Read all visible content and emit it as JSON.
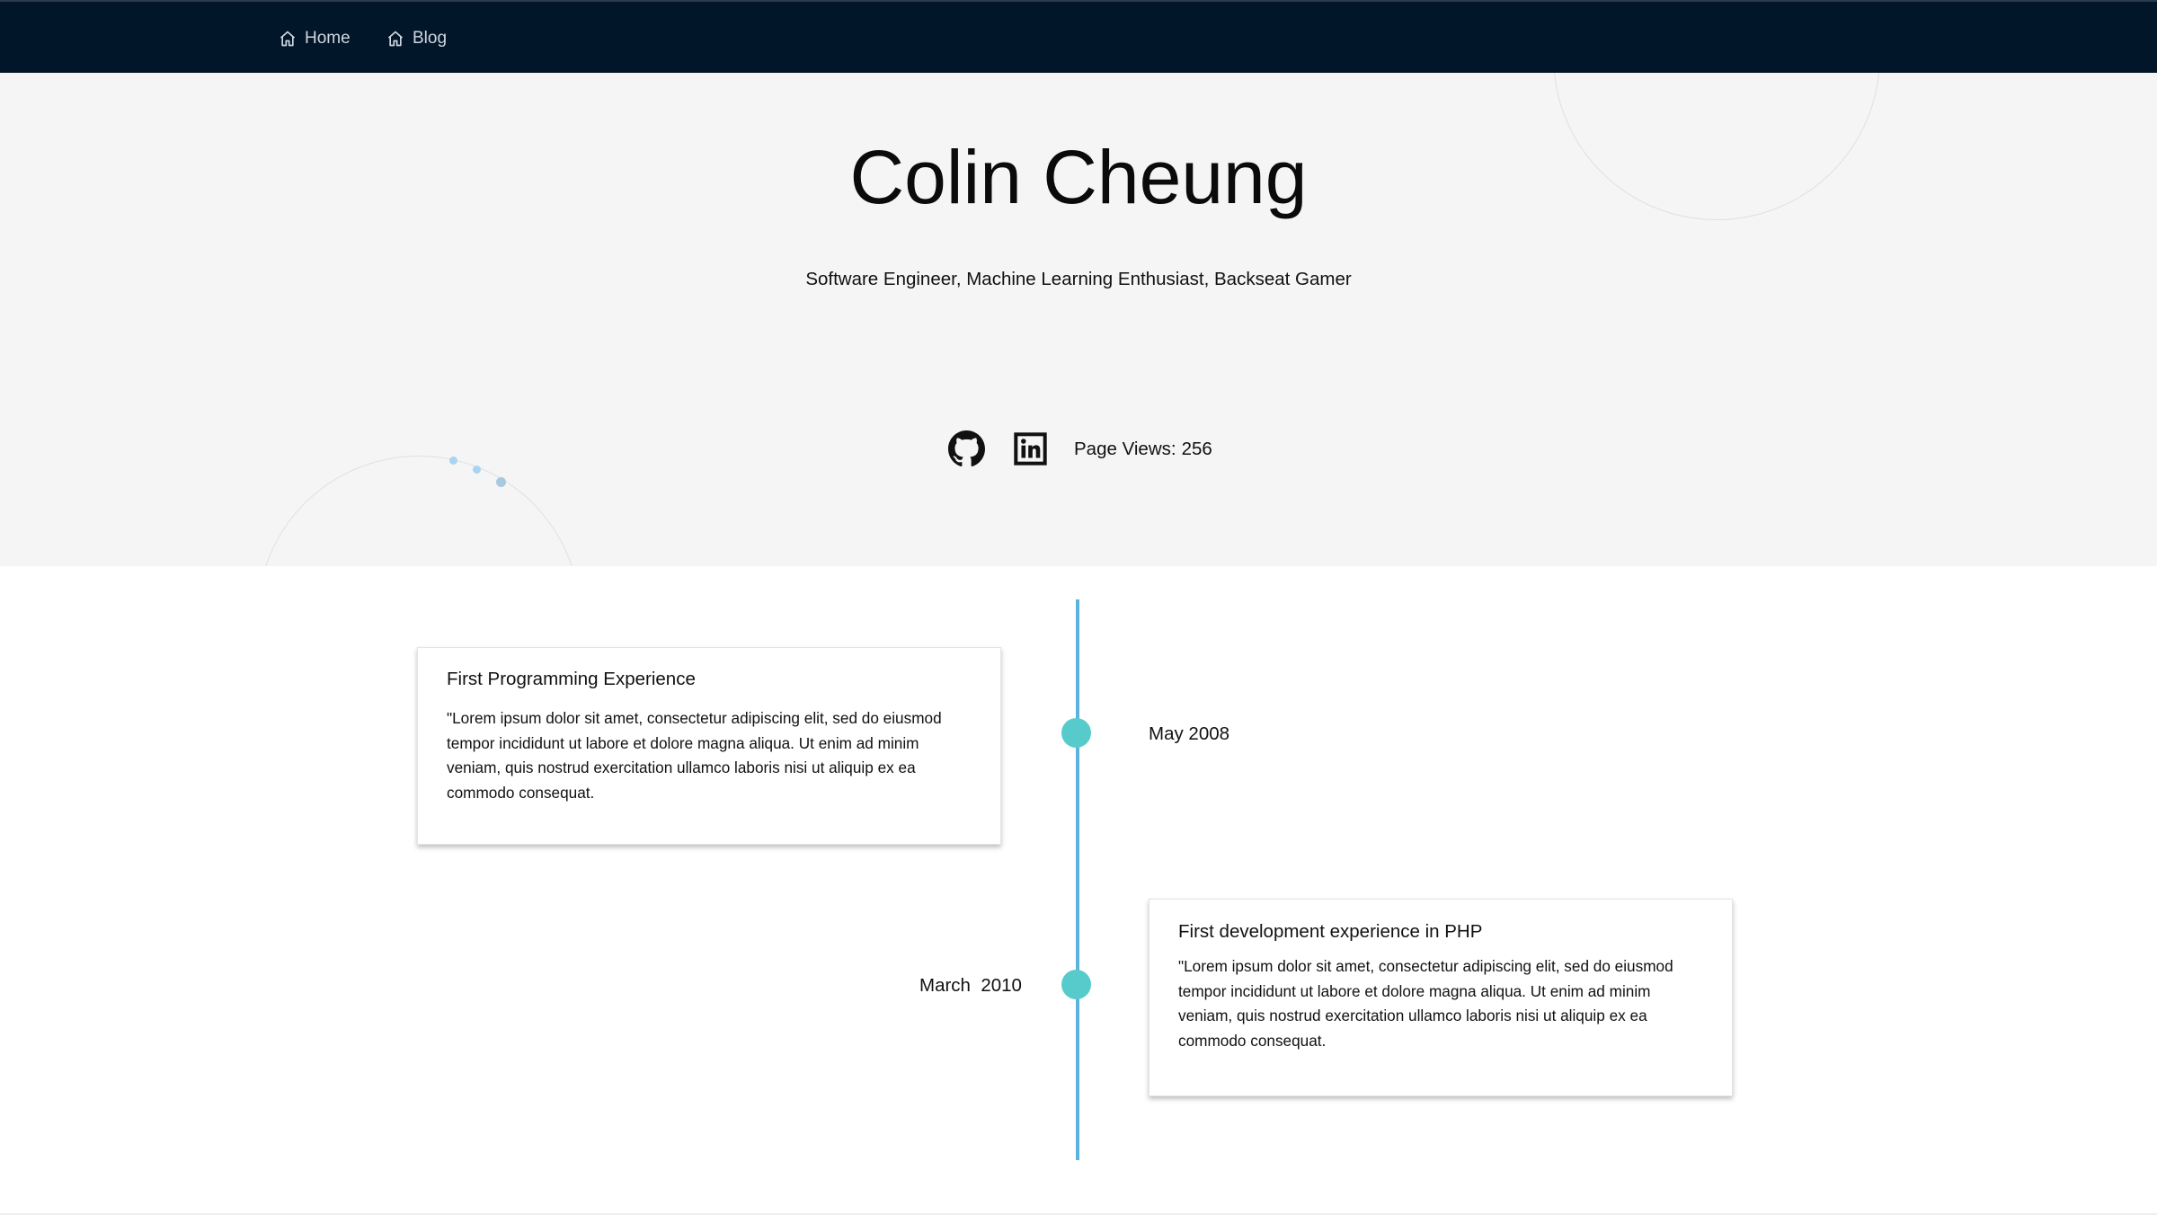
{
  "nav": {
    "items": [
      {
        "label": "Home",
        "icon": "home-icon"
      },
      {
        "label": "Blog",
        "icon": "home-icon"
      }
    ]
  },
  "hero": {
    "title": "Colin Cheung",
    "subtitle": "Software Engineer, Machine Learning Enthusiast, Backseat Gamer",
    "social": [
      "github-icon",
      "linkedin-icon"
    ],
    "page_views_label": "Page Views:",
    "page_views_value": "256"
  },
  "timeline": {
    "events": [
      {
        "date": "May 2008",
        "title": "First Programming Experience",
        "text": "\"Lorem ipsum dolor sit amet, consectetur adipiscing elit, sed do eiusmod tempor incididunt ut labore et dolore magna aliqua. Ut enim ad minim veniam, quis nostrud exercitation ullamco laboris nisi ut aliquip ex ea commodo consequat."
      },
      {
        "date": "March  2010",
        "title": "First development experience in PHP",
        "text": "\"Lorem ipsum dolor sit amet, consectetur adipiscing elit, sed do eiusmod tempor incididunt ut labore et dolore magna aliqua. Ut enim ad minim veniam, quis nostrud exercitation ullamco laboris nisi ut aliquip ex ea commodo consequat."
      }
    ]
  },
  "colors": {
    "navbar": "#02162a",
    "hero_bg": "#f5f5f5",
    "timeline_line": "#5cb3e0",
    "timeline_dot": "#57cbcc"
  }
}
